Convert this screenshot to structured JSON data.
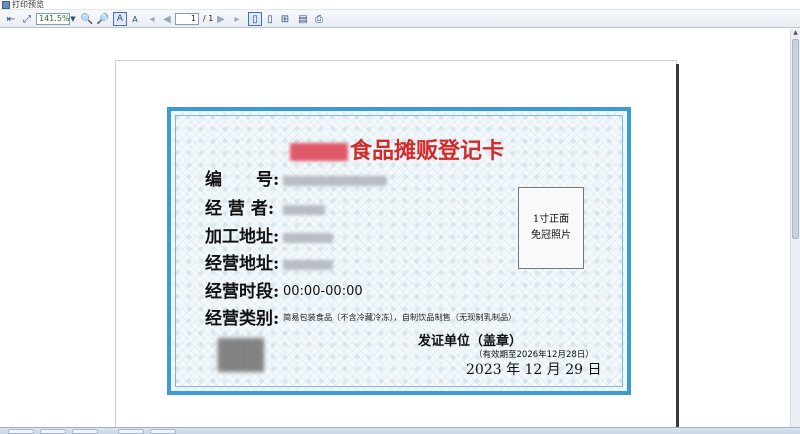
{
  "window": {
    "title": "打印预览"
  },
  "toolbar": {
    "zoom": "141.5%",
    "page_current": "1",
    "page_separator": "/",
    "page_total": "1"
  },
  "card": {
    "title_suffix": "食品摊贩登记卡",
    "labels": {
      "number": "编　　号:",
      "operator": "经 营 者:",
      "processing_address": "加工地址:",
      "business_address": "经营地址:",
      "business_hours": "经营时段:",
      "business_category": "经营类别:"
    },
    "values": {
      "business_hours": "00:00-00:00",
      "business_category": "简易包装食品（不含冷藏冷冻），自制饮品制售（无现制乳制品）"
    },
    "photo": {
      "line1": "1寸正面",
      "line2": "免冠照片"
    },
    "issuer": "发证单位（盖章）",
    "validity": "（有效期至2026年12月28日）",
    "issue_date": "2023 年 12 月 29 日"
  },
  "colors": {
    "title_red": "#d42a2a",
    "border_blue": "#3b9bd6"
  }
}
